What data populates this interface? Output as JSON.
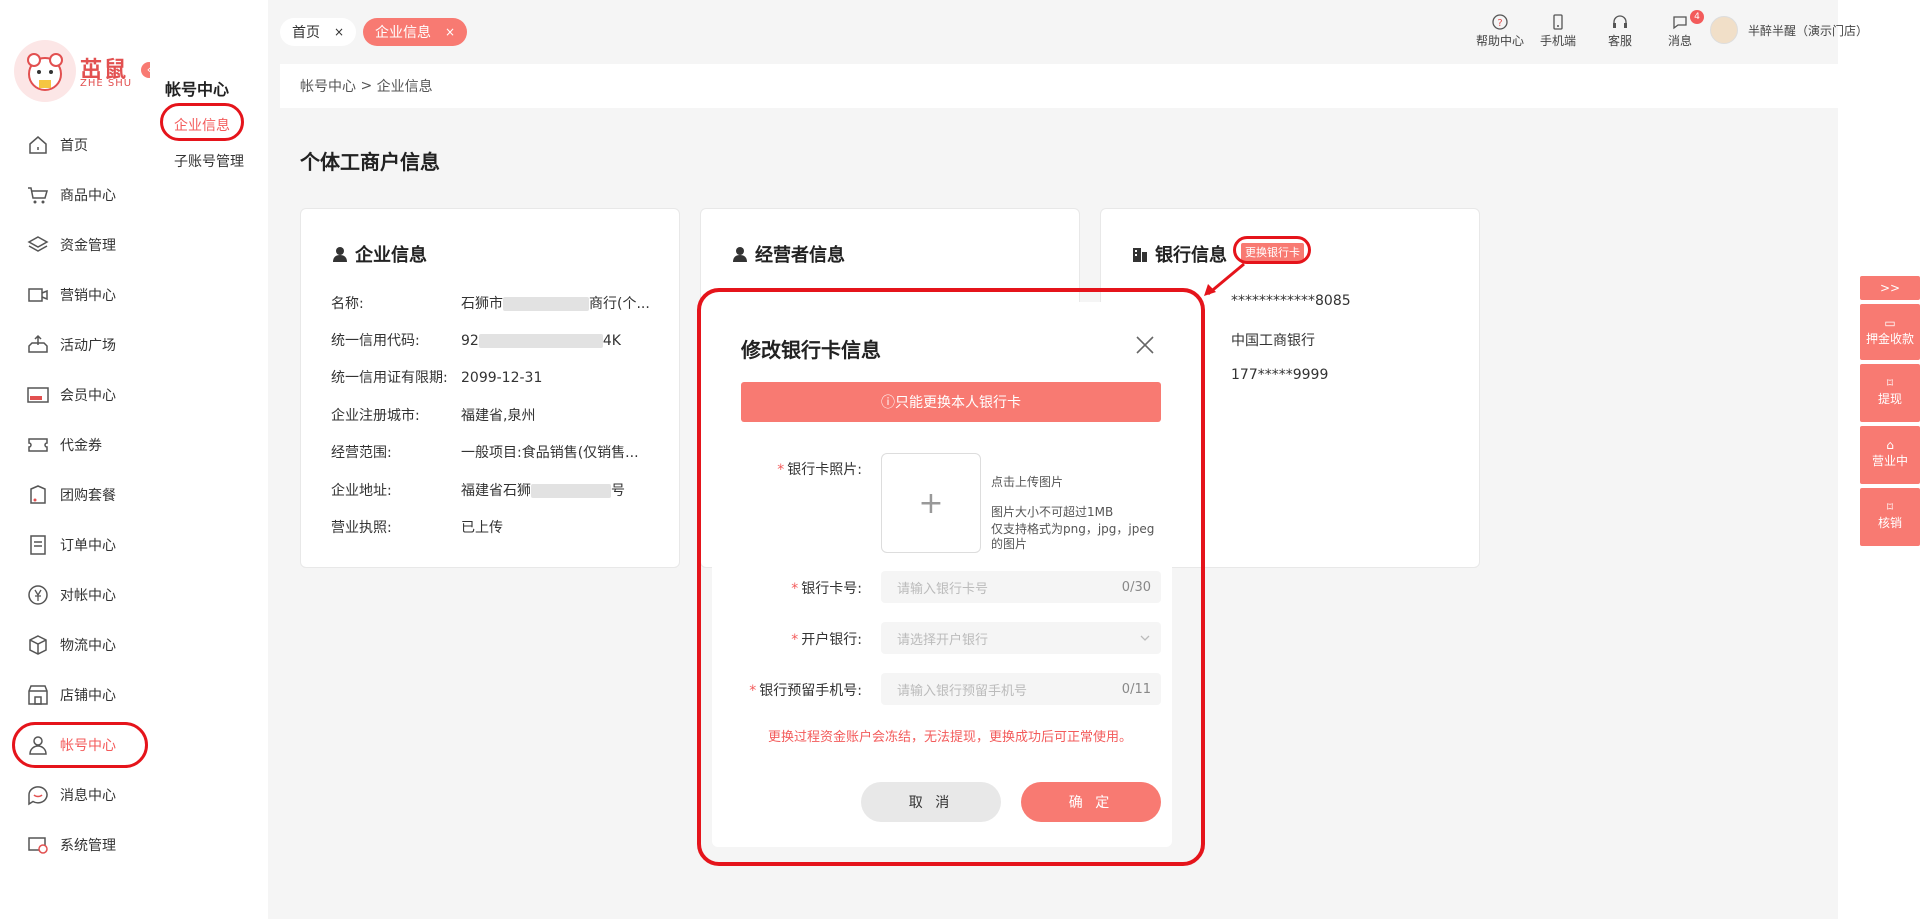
{
  "app": {
    "logo_text": "茁鼠",
    "logo_sub": "ZHE SHU"
  },
  "sidebar": {
    "items": [
      {
        "label": "首页",
        "icon": "home-icon"
      },
      {
        "label": "商品中心",
        "icon": "cart-icon"
      },
      {
        "label": "资金管理",
        "icon": "layers-icon"
      },
      {
        "label": "营销中心",
        "icon": "megaphone-icon"
      },
      {
        "label": "活动广场",
        "icon": "upload-tray-icon"
      },
      {
        "label": "会员中心",
        "icon": "vip-card-icon"
      },
      {
        "label": "代金券",
        "icon": "ticket-icon"
      },
      {
        "label": "团购套餐",
        "icon": "package-icon"
      },
      {
        "label": "订单中心",
        "icon": "order-icon"
      },
      {
        "label": "对帐中心",
        "icon": "yen-icon"
      },
      {
        "label": "物流中心",
        "icon": "box-icon"
      },
      {
        "label": "店铺中心",
        "icon": "store-icon"
      },
      {
        "label": "帐号中心",
        "icon": "user-icon",
        "active": true
      },
      {
        "label": "消息中心",
        "icon": "chat-icon"
      },
      {
        "label": "系统管理",
        "icon": "settings-icon"
      }
    ]
  },
  "subsidebar": {
    "title": "帐号中心",
    "items": [
      "企业信息",
      "子账号管理"
    ]
  },
  "tabs": {
    "home": "首页",
    "enterprise": "企业信息",
    "close": "×"
  },
  "toolbar": {
    "help": "帮助中心",
    "mobile": "手机端",
    "service": "客服",
    "messages": "消息",
    "message_count": "4",
    "user": "半醉半醒（演示门店）"
  },
  "breadcrumb": {
    "root": "帐号中心",
    "sep": " > ",
    "current": "企业信息"
  },
  "page": {
    "title": "个体工商户信息"
  },
  "enterprise_card": {
    "title": "企业信息",
    "rows": [
      {
        "label": "名称:",
        "value_prefix": "石狮市",
        "value_suffix": "商行(个..."
      },
      {
        "label": "统一信用代码:",
        "value_prefix": "92",
        "value_suffix": "4K"
      },
      {
        "label": "统一信用证有限期:",
        "value_prefix": "2099-12-31",
        "value_suffix": ""
      },
      {
        "label": "企业注册城市:",
        "value_prefix": "福建省,泉州",
        "value_suffix": ""
      },
      {
        "label": "经营范围:",
        "value_prefix": "一般项目:食品销售(仅销售...",
        "value_suffix": ""
      },
      {
        "label": "企业地址:",
        "value_prefix": "福建省石狮",
        "value_suffix": "号"
      },
      {
        "label": "营业执照:",
        "value_prefix": "已上传",
        "value_suffix": ""
      }
    ]
  },
  "operator_card": {
    "title": "经营者信息"
  },
  "bank_card": {
    "title": "银行信息",
    "change_link": "更换银行卡",
    "card_number": "************8085",
    "bank_name": "中国工商银行",
    "phone": "177*****9999"
  },
  "side_tools": {
    "expand": ">>",
    "deposit": "押金收款",
    "withdraw": "提现",
    "business": "营业中",
    "verify": "核销"
  },
  "modal": {
    "title": "修改银行卡信息",
    "warning": "ⓘ只能更换本人银行卡",
    "photo_label": "银行卡照片:",
    "upload_plus": "+",
    "upload_hint1": "点击上传图片",
    "upload_hint2": "图片大小不可超过1MB",
    "upload_hint3": "仅支持格式为png，jpg，jpeg",
    "upload_hint4": "的图片",
    "card_no_label": "银行卡号:",
    "card_no_placeholder": "请输入银行卡号",
    "card_no_count": "0/30",
    "bank_label": "开户银行:",
    "bank_placeholder": "请选择开户银行",
    "phone_label": "银行预留手机号:",
    "phone_placeholder": "请输入银行预留手机号",
    "phone_count": "0/11",
    "required_mark": "*",
    "note": "更换过程资金账户会冻结，无法提现，更换成功后可正常使用。",
    "cancel": "取 消",
    "confirm": "确 定"
  },
  "colors": {
    "accent": "#f87a72",
    "active_text": "#f35b5b",
    "annotation": "#e5141b",
    "page_bg": "#f5f5f5"
  }
}
